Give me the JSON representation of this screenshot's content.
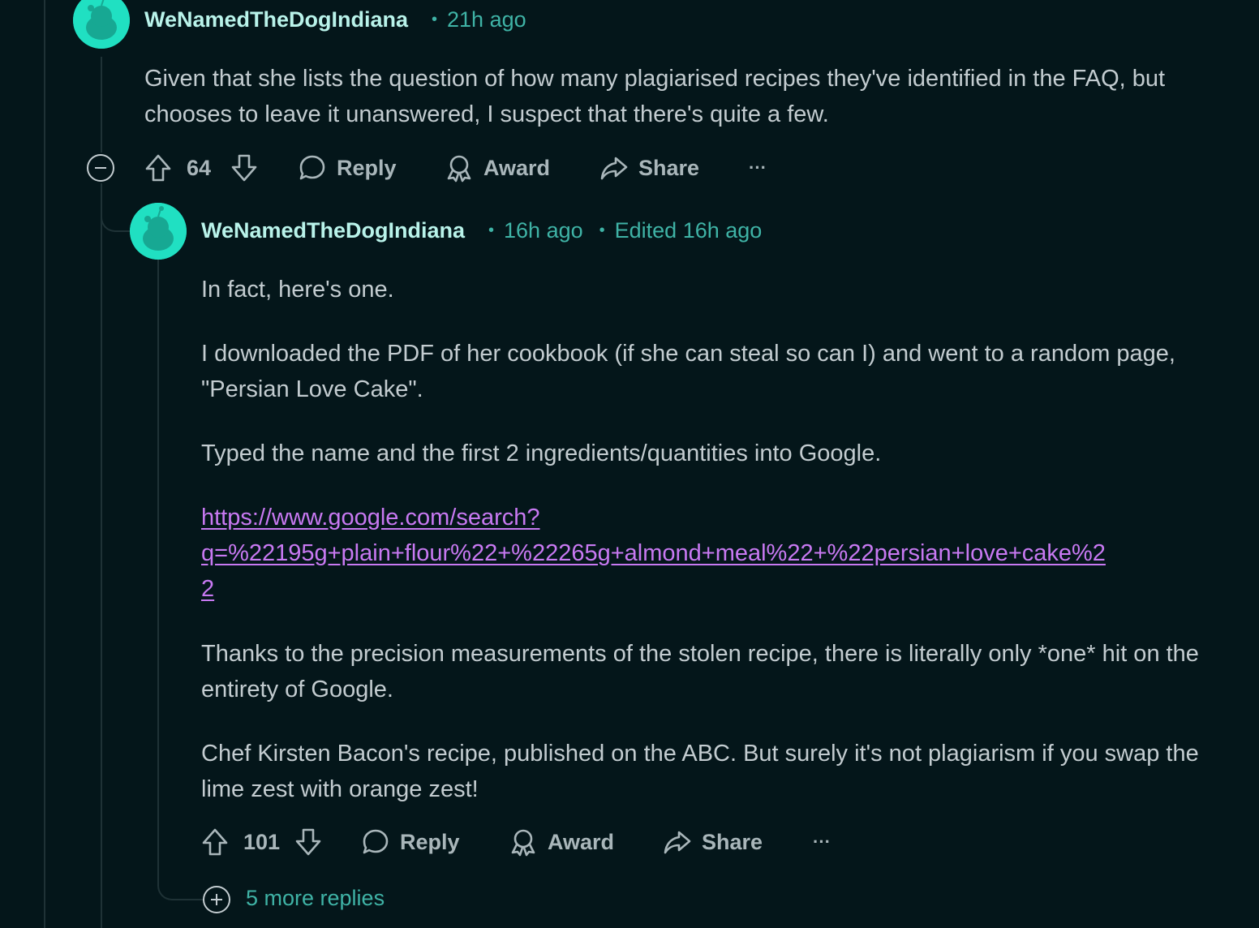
{
  "comment1": {
    "username": "WeNamedTheDogIndiana",
    "time": "21h ago",
    "body": "Given that she lists the question of how many plagiarised recipes they've identified in the FAQ, but chooses to leave it unanswered, I suspect that there's quite a few.",
    "votes": "64",
    "actions": {
      "reply": "Reply",
      "award": "Award",
      "share": "Share",
      "more": "···"
    }
  },
  "comment2": {
    "username": "WeNamedTheDogIndiana",
    "time": "16h ago",
    "edited": "Edited 16h ago",
    "paragraphs": [
      "In fact, here's one.",
      "I downloaded the PDF of her cookbook (if she can steal so can I) and went to a random page, \"Persian Love Cake\".",
      "Typed the name and the first 2 ingredients/quantities into Google.",
      "Thanks to the precision measurements of the stolen recipe, there is literally only *one* hit on the entirety of Google.",
      "Chef Kirsten Bacon's recipe, published on the ABC. But surely it's not plagiarism if you swap the lime zest with orange zest!"
    ],
    "link": "https://www.google.com/search?q=%22195g+plain+flour%22+%22265g+almond+meal%22+%22persian+love+cake%22",
    "link_lines": [
      "https://www.google.com/search?",
      "q=%22195g+plain+flour%22+%22265g+almond+meal%22+%22persian+love+cake%2",
      "2"
    ],
    "votes": "101",
    "actions": {
      "reply": "Reply",
      "award": "Award",
      "share": "Share",
      "more": "···"
    }
  },
  "more_replies": "5 more replies",
  "colors": {
    "background": "#04161a",
    "accent": "#3fb3a6",
    "username": "#b9f3ea",
    "link": "#c879f2",
    "avatar": "#20e0c2"
  }
}
